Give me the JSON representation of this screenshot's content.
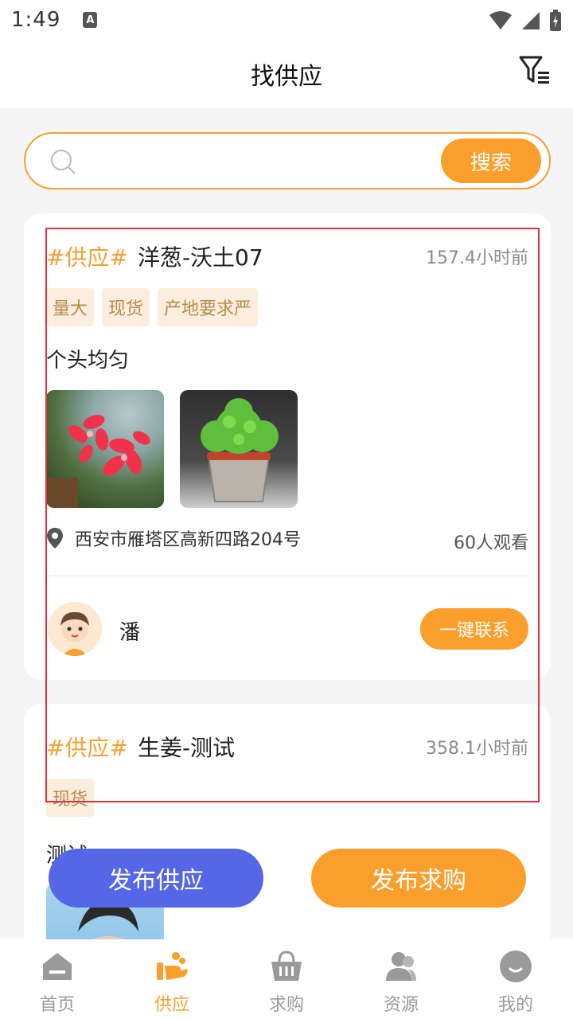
{
  "status_bar": {
    "time": "1:49",
    "notification_letter": "A"
  },
  "header": {
    "title": "找供应"
  },
  "search": {
    "placeholder": "",
    "button_label": "搜索"
  },
  "cards": [
    {
      "type_tag": "#供应#",
      "name": "洋葱-沃土07",
      "time_ago": "157.4小时前",
      "tags": [
        "量大",
        "现货",
        "产地要求严"
      ],
      "description": "个头均匀",
      "location": "西安市雁塔区高新四路204号",
      "views": "60人观看",
      "user_name": "潘",
      "contact_label": "一键联系"
    },
    {
      "type_tag": "#供应#",
      "name": "生姜-测试",
      "time_ago": "358.1小时前",
      "tags": [
        "现货"
      ],
      "description": "测试"
    }
  ],
  "actions": {
    "publish_supply": "发布供应",
    "publish_purchase": "发布求购"
  },
  "tabbar": {
    "items": [
      {
        "label": "首页",
        "icon": "home-icon"
      },
      {
        "label": "供应",
        "icon": "supply-icon"
      },
      {
        "label": "求购",
        "icon": "basket-icon"
      },
      {
        "label": "资源",
        "icon": "users-icon"
      },
      {
        "label": "我的",
        "icon": "profile-icon"
      }
    ],
    "active_index": 1
  },
  "colors": {
    "accent": "#fa9f2b",
    "primary_blue": "#5566e6",
    "highlight_border": "#e0313c"
  }
}
